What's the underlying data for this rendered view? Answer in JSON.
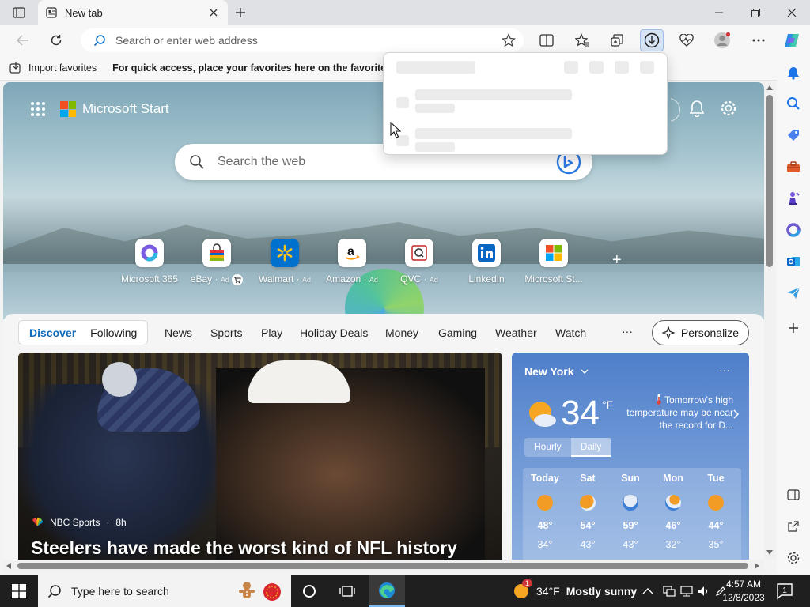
{
  "browser": {
    "tab_title": "New tab",
    "address_placeholder": "Search or enter web address",
    "favorites_import": "Import favorites",
    "favorites_hint": "For quick access, place your favorites here on the favorites bar."
  },
  "page": {
    "brand": "Microsoft Start",
    "search_placeholder": "Search the web",
    "quick_links": [
      {
        "label": "Microsoft 365",
        "ad": ""
      },
      {
        "label": "eBay",
        "ad": "Ad"
      },
      {
        "label": "Walmart",
        "ad": "Ad"
      },
      {
        "label": "Amazon",
        "ad": "Ad"
      },
      {
        "label": "QVC",
        "ad": "Ad"
      },
      {
        "label": "LinkedIn",
        "ad": ""
      },
      {
        "label": "Microsoft St...",
        "ad": ""
      }
    ],
    "feed_tabs": [
      "Discover",
      "Following"
    ],
    "feed_nav": [
      "News",
      "Sports",
      "Play",
      "Holiday Deals",
      "Money",
      "Gaming",
      "Weather",
      "Watch"
    ],
    "more": "···",
    "personalize": "Personalize",
    "news": {
      "source": "NBC Sports",
      "age": "8h",
      "headline": "Steelers have made the worst kind of NFL history"
    },
    "weather": {
      "city": "New York",
      "temp": "34",
      "unit": "°F",
      "note": "Tomorrow's high temperature may be near the record for D...",
      "tabs": [
        "Hourly",
        "Daily"
      ],
      "days": [
        {
          "name": "Today",
          "hi": "48°",
          "lo": "34°",
          "icon": "sun-icon"
        },
        {
          "name": "Sat",
          "hi": "54°",
          "lo": "43°",
          "icon": "partly-cloudy-icon"
        },
        {
          "name": "Sun",
          "hi": "59°",
          "lo": "43°",
          "icon": "rain-icon"
        },
        {
          "name": "Mon",
          "hi": "46°",
          "lo": "32°",
          "icon": "sun-rain-icon"
        },
        {
          "name": "Tue",
          "hi": "44°",
          "lo": "35°",
          "icon": "sun-icon"
        }
      ]
    }
  },
  "taskbar": {
    "search_placeholder": "Type here to search",
    "weather_temp": "34°F",
    "weather_desc": "Mostly sunny",
    "weather_badge": "1",
    "time": "4:57 AM",
    "date": "12/8/2023",
    "notification_count": "1"
  },
  "colors": {
    "accent": "#0f6cbd",
    "taskbar": "#1f1f1f",
    "weather_card": "#5b89cf"
  }
}
